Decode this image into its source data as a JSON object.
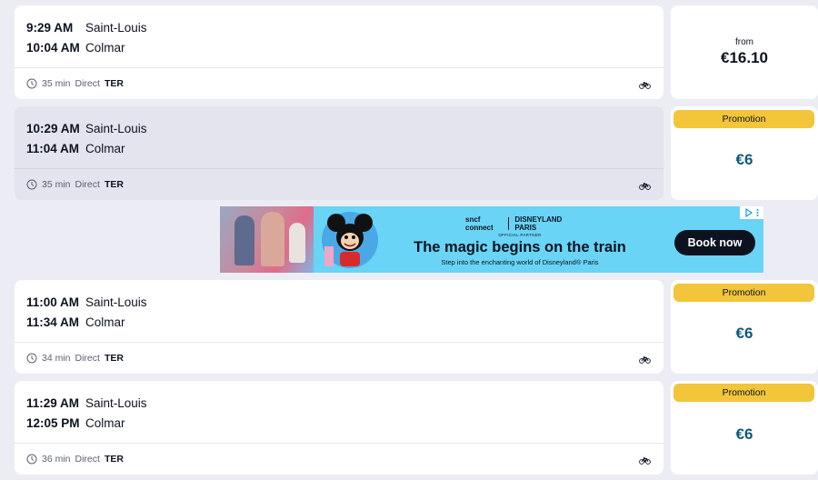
{
  "trips": [
    {
      "departure": {
        "time": "9:29 AM",
        "station": "Saint-Louis"
      },
      "arrival": {
        "time": "10:04 AM",
        "station": "Colmar"
      },
      "duration": "35 min",
      "connection": "Direct",
      "mode": "TER",
      "bike_icon": "bicycle-icon",
      "price": {
        "prefix": "from",
        "amount": "€16.10",
        "badge": ""
      }
    },
    {
      "departure": {
        "time": "10:29 AM",
        "station": "Saint-Louis"
      },
      "arrival": {
        "time": "11:04 AM",
        "station": "Colmar"
      },
      "duration": "35 min",
      "connection": "Direct",
      "mode": "TER",
      "bike_icon": "bicycle-icon",
      "price": {
        "prefix": "",
        "amount": "€6",
        "badge": "Promotion"
      }
    },
    {
      "departure": {
        "time": "11:00 AM",
        "station": "Saint-Louis"
      },
      "arrival": {
        "time": "11:34 AM",
        "station": "Colmar"
      },
      "duration": "34 min",
      "connection": "Direct",
      "mode": "TER",
      "bike_icon": "bicycle-icon",
      "price": {
        "prefix": "",
        "amount": "€6",
        "badge": "Promotion"
      }
    },
    {
      "departure": {
        "time": "11:29 AM",
        "station": "Saint-Louis"
      },
      "arrival": {
        "time": "12:05 PM",
        "station": "Colmar"
      },
      "duration": "36 min",
      "connection": "Direct",
      "mode": "TER",
      "bike_icon": "bicycle-icon",
      "price": {
        "prefix": "",
        "amount": "€6",
        "badge": "Promotion"
      }
    }
  ],
  "ad": {
    "brand_left": "sncf connect",
    "brand_right": "DISNEYLAND PARIS",
    "partner_line": "OFFICIAL PARTNER",
    "headline": "The magic begins on the train",
    "subline": "Step into the enchanting world of Disneyland® Paris",
    "cta": "Book now"
  },
  "colors": {
    "page_bg": "#ecedf4",
    "card_bg": "#ffffff",
    "hover_card_bg": "#e3e4ee",
    "promo_badge": "#f2c53a",
    "promo_price": "#0e5a75",
    "ad_bg": "#69d4f5",
    "text": "#0c131f"
  }
}
